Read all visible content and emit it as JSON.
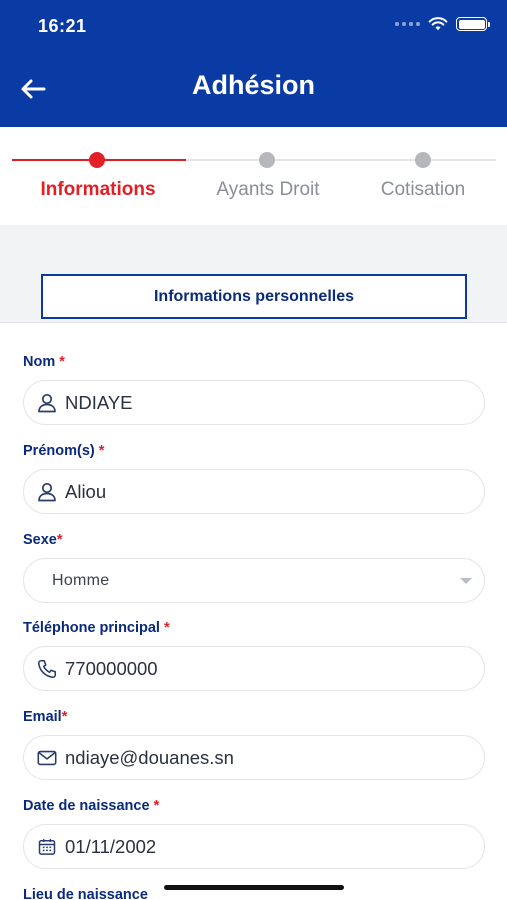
{
  "status_bar": {
    "time": "16:21"
  },
  "header": {
    "title": "Adhésion"
  },
  "steps": [
    {
      "label": "Informations",
      "active": true
    },
    {
      "label": "Ayants Droit",
      "active": false
    },
    {
      "label": "Cotisation",
      "active": false
    }
  ],
  "section": {
    "button_label": "Informations personnelles"
  },
  "form": {
    "nom": {
      "label": "Nom",
      "required_mark": "*",
      "value": "NDIAYE",
      "icon": "person-icon"
    },
    "prenom": {
      "label": "Prénom(s)",
      "required_mark": "*",
      "value": "Aliou",
      "icon": "person-icon"
    },
    "sexe": {
      "label": "Sexe",
      "required_mark": "*",
      "value": "Homme",
      "icon": "chevron-down-icon"
    },
    "telephone": {
      "label": "Téléphone principal",
      "required_mark": "*",
      "value": "770000000",
      "icon": "phone-icon"
    },
    "email": {
      "label": "Email",
      "required_mark": "*",
      "value": "ndiaye@douanes.sn",
      "icon": "mail-icon"
    },
    "naissance": {
      "label": "Date de naissance",
      "required_mark": "*",
      "value": "01/11/2002",
      "icon": "calendar-icon"
    },
    "lieu": {
      "label": "Lieu de naissance"
    }
  },
  "colors": {
    "brand_blue": "#0a3aa4",
    "active_red": "#e21f26",
    "inactive_grey": "#b5b7bc",
    "label_navy": "#0a2a7a"
  }
}
